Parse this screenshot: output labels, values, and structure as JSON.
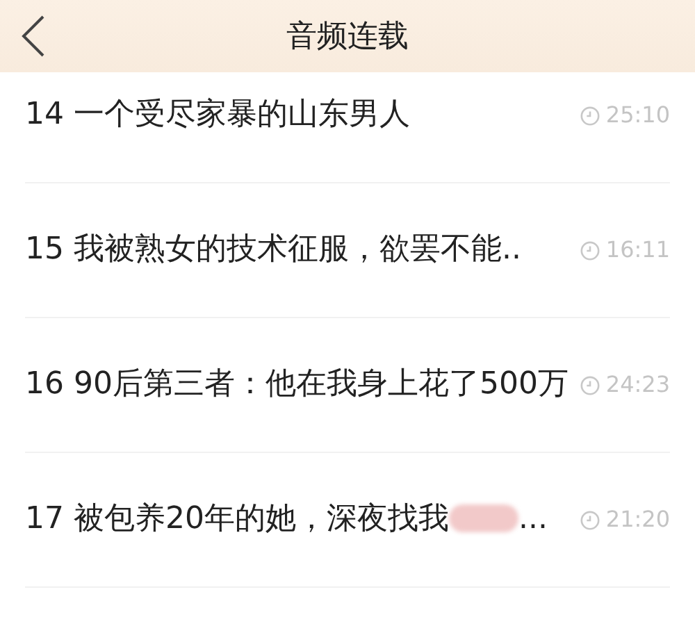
{
  "header": {
    "title": "音频连载"
  },
  "episodes": [
    {
      "title": "14 一个受尽家暴的山东男人",
      "duration": "25:10",
      "censored": false
    },
    {
      "title": "15 我被熟女的技术征服，欲罢不能..",
      "duration": "16:11",
      "censored": false
    },
    {
      "title": "16 90后第三者：他在我身上花了500万",
      "duration": "24:23",
      "censored": false
    },
    {
      "title": "17 被包养20年的她，深夜找我",
      "title_end": "...",
      "duration": "21:20",
      "censored": true
    }
  ]
}
